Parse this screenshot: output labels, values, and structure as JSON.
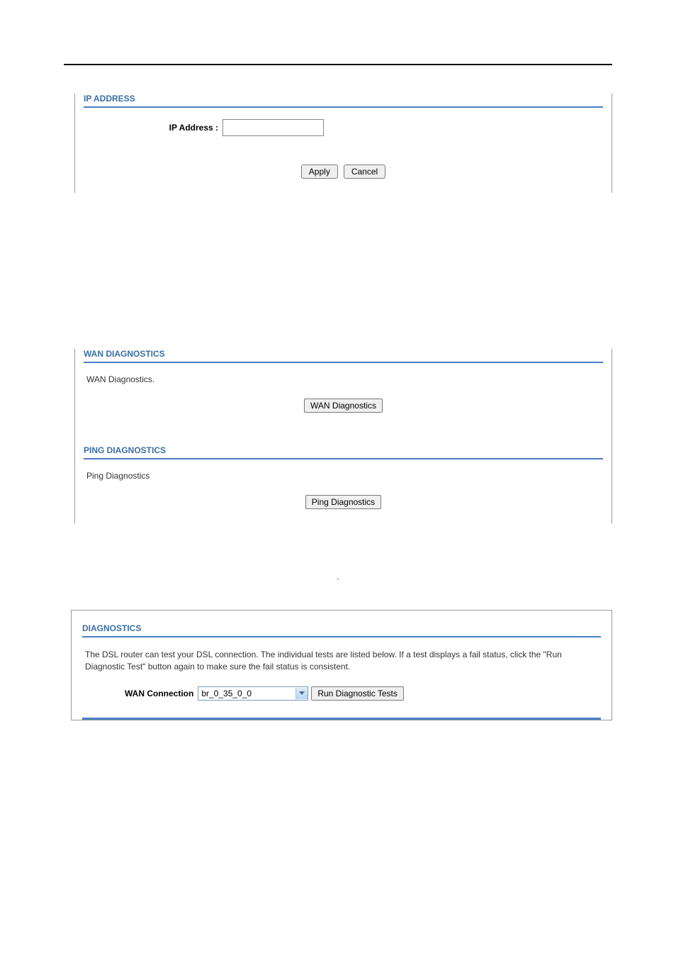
{
  "ipAddress": {
    "header": "IP ADDRESS",
    "label": "IP Address :",
    "value": "",
    "applyLabel": "Apply",
    "cancelLabel": "Cancel"
  },
  "wanDiag": {
    "header": "WAN DIAGNOSTICS",
    "text": "WAN Diagnostics.",
    "buttonLabel": "WAN Diagnostics"
  },
  "pingDiag": {
    "header": "PING DIAGNOSTICS",
    "text": "Ping Diagnostics",
    "buttonLabel": "Ping Diagnostics"
  },
  "dot": ".",
  "diagnostics": {
    "header": "DIAGNOSTICS",
    "description": "The DSL router can test your DSL connection. The individual tests are listed below. If a test displays a fail status, click the \"Run Diagnostic Test\" button again to make sure the fail status is consistent.",
    "wanConnectionLabel": "WAN Connection",
    "wanConnectionValue": "br_0_35_0_0",
    "runButtonLabel": "Run Diagnostic Tests"
  }
}
